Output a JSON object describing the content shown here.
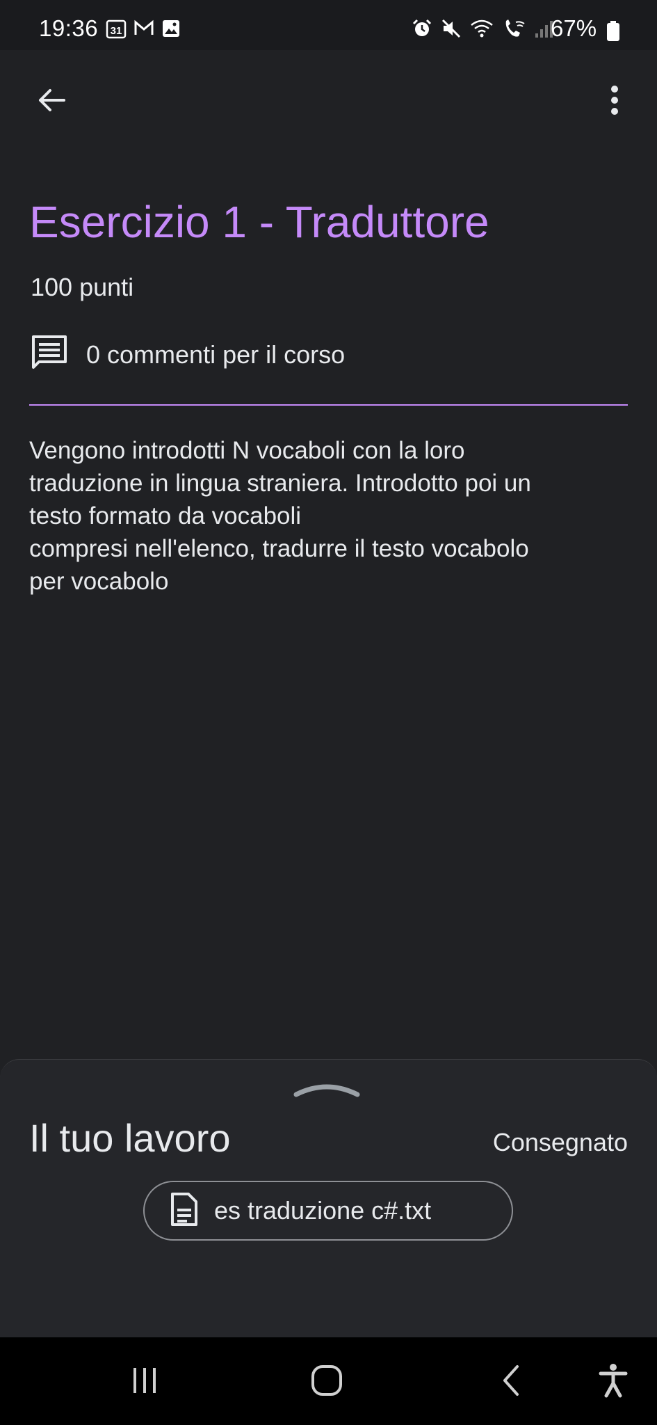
{
  "status_bar": {
    "time": "19:36",
    "calendar_day": "31",
    "battery_percent": "67%",
    "left_icons": [
      "calendar-icon",
      "gmail-icon",
      "gallery-icon"
    ],
    "right_icons": [
      "alarm-icon",
      "mute-icon",
      "wifi-icon",
      "wifi-calling-icon",
      "signal-icon",
      "battery-icon"
    ]
  },
  "app_bar": {
    "back_icon": "arrow-back-icon",
    "menu_icon": "more-vert-icon"
  },
  "assignment": {
    "title": "Esercizio 1 - Traduttore",
    "points": "100 punti",
    "comments_label": "0 commenti per il corso",
    "description": "Vengono introdotti N vocaboli con la loro\ntraduzione in lingua straniera. Introdotto poi un\ntesto formato da vocaboli\ncompresi nell'elenco, tradurre il testo vocabolo\nper vocabolo"
  },
  "your_work": {
    "title": "Il tuo lavoro",
    "status": "Consegnato",
    "attachment_name": "es traduzione c#.txt",
    "attachment_icon": "document-icon"
  },
  "nav_bar": {
    "buttons": [
      "recent-apps-icon",
      "home-icon",
      "back-icon",
      "accessibility-icon"
    ]
  },
  "colors": {
    "accent": "#c58af9",
    "background": "#202124",
    "sheet": "#25262a",
    "text": "#e8eaed"
  }
}
